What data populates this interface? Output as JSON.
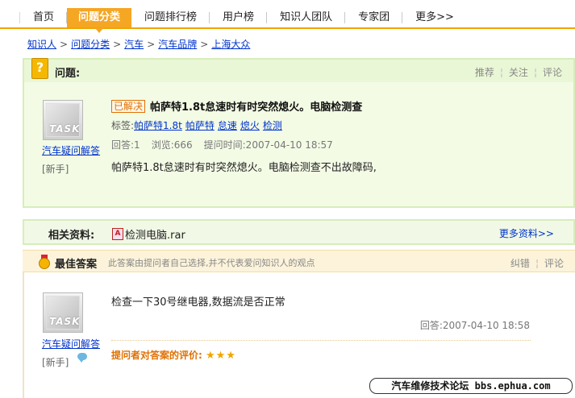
{
  "nav": {
    "items": [
      {
        "label": "首页",
        "active": false
      },
      {
        "label": "问题分类",
        "active": true
      },
      {
        "label": "问题排行榜",
        "active": false
      },
      {
        "label": "用户榜",
        "active": false
      },
      {
        "label": "知识人团队",
        "active": false
      },
      {
        "label": "专家团",
        "active": false
      },
      {
        "label": "更多>>",
        "active": false
      }
    ]
  },
  "breadcrumb": {
    "items": [
      "知识人",
      "问题分类",
      "汽车",
      "汽车品牌",
      "上海大众"
    ],
    "separator": ">"
  },
  "question": {
    "header_icon": "?",
    "header_title": "问题:",
    "actions": [
      "推荐",
      "关注",
      "评论"
    ],
    "status_badge": "已解决",
    "title": "帕萨特1.8t怠速时有时突然熄火。电脑检测查",
    "tags_label": "标签:",
    "tags": [
      "帕萨特1.8t",
      "帕萨特",
      "怠速",
      "熄火",
      "检测"
    ],
    "answers": "回答:1",
    "views": "浏览:666",
    "time": "提问时间:2007-04-10 18:57",
    "description": "帕萨特1.8t怠速时有时突然熄火。电脑检测查不出故障码,",
    "asker": {
      "avatar_text": "TASK",
      "name": "汽车疑问解答",
      "rank": "[新手]"
    }
  },
  "related": {
    "label": "相关资料:",
    "file_icon": "rar-file-icon",
    "file_name": "检测电脑.rar",
    "more": "更多资料>>"
  },
  "best_answer": {
    "title": "最佳答案",
    "note": "此答案由提问者自己选择,并不代表爱问知识人的观点",
    "actions": [
      "纠错",
      "评论"
    ],
    "text": "检查一下30号继电器,数据流是否正常",
    "date": "回答:2007-04-10 18:58",
    "rating_label": "提问者对答案的评价:",
    "rating_stars": 3,
    "rating_star_glyphs": "★★★",
    "answerer": {
      "avatar_text": "TASK",
      "name": "汽车疑问解答",
      "rank": "[新手]"
    }
  },
  "watermark": "汽车维修技术论坛 bbs.ephua.com",
  "colors": {
    "accent": "#f5a623",
    "question_bg": "#f3fbe5",
    "answer_header_bg": "#fcf3da",
    "link": "#0033cc"
  }
}
